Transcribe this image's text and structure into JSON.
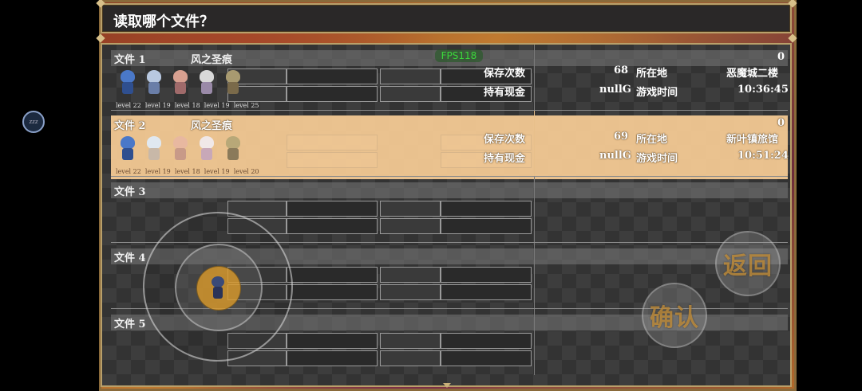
{
  "dialog": {
    "title": "读取哪个文件？"
  },
  "overlay": {
    "fps": "FPS118",
    "bubble": "zzz"
  },
  "labels": {
    "save_count": "保存次数",
    "location": "所在地",
    "money": "持有现金",
    "play_time": "游戏时间"
  },
  "files": [
    {
      "label": "文件 1",
      "game_name": "风之圣痕",
      "corner_value": "0",
      "save_count": "68",
      "location": "恶魔城二楼",
      "money": "nullG",
      "play_time": "10:36:45",
      "levels": [
        "level 22",
        "level 19",
        "level 18",
        "level 19",
        "level 25"
      ]
    },
    {
      "label": "文件 2",
      "game_name": "风之圣痕",
      "corner_value": "0",
      "save_count": "69",
      "location": "新叶镇旅馆",
      "money": "nullG",
      "play_time": "10:51:24",
      "levels": [
        "level 22",
        "level 19",
        "level 18",
        "level 19",
        "level 20"
      ]
    },
    {
      "label": "文件 3"
    },
    {
      "label": "文件 4"
    },
    {
      "label": "文件 5"
    }
  ],
  "controls": {
    "back_label": "返回",
    "confirm_label": "确认"
  },
  "colors": {
    "frame_gold": "#b9a06a",
    "selected_row": "#f3c993",
    "fps_green": "#3bd63b",
    "button_text": "#cd963c"
  }
}
